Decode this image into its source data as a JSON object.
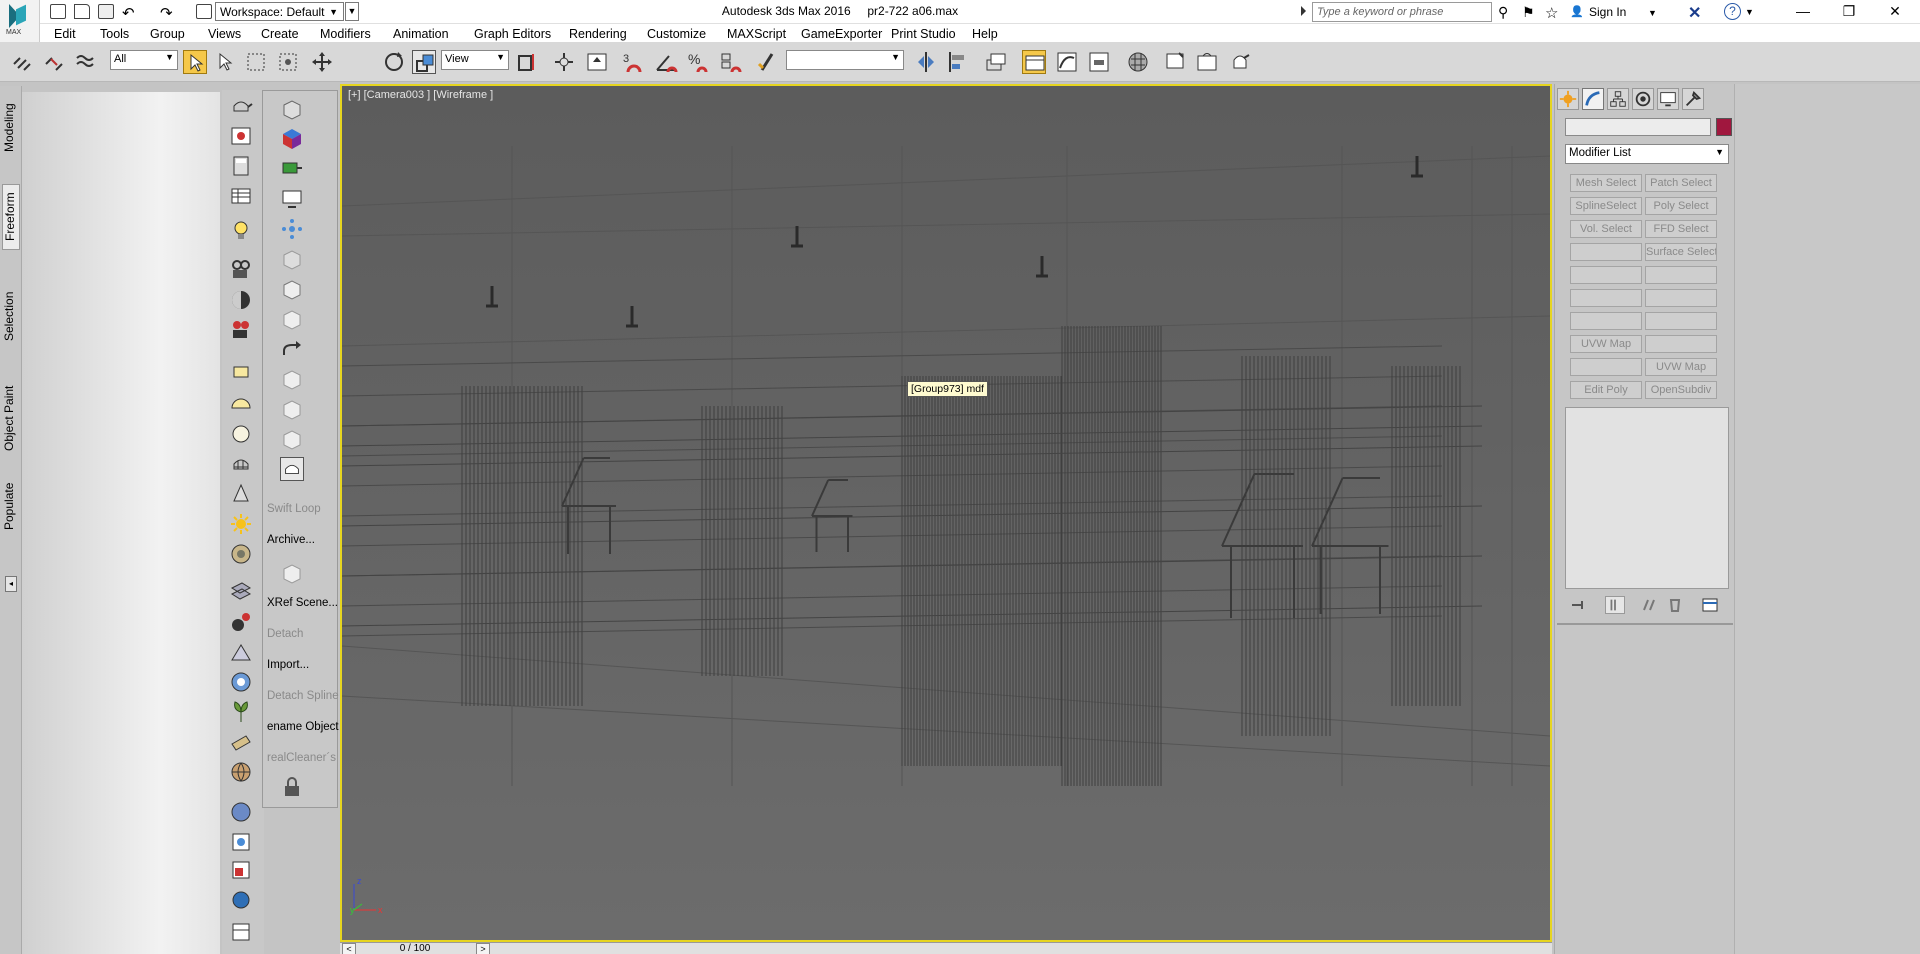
{
  "window": {
    "title": "Autodesk 3ds Max 2016",
    "filename": "pr2-722 a06.max",
    "logo_text": "MAX",
    "workspace": "Workspace: Default",
    "search_placeholder": "Type a keyword or phrase",
    "sign_in": "Sign In",
    "help_icon": "help-icon"
  },
  "menu": [
    "Edit",
    "Tools",
    "Group",
    "Views",
    "Create",
    "Modifiers",
    "Animation",
    "Graph Editors",
    "Rendering",
    "Customize",
    "MAXScript",
    "GameExporter",
    "Print Studio",
    "Help"
  ],
  "toolbar": {
    "selection_filter": "All",
    "reference_coord": "View",
    "snap_number": "3",
    "named_selection": ""
  },
  "ribbon_tabs": [
    "Modeling",
    "Freeform",
    "Selection",
    "Object Paint",
    "Populate"
  ],
  "side_strip": {
    "labels": [
      "Swift Loop",
      "Archive...",
      "XRef Scene...",
      "Detach",
      "Import...",
      "Detach Spline",
      "ename Objects",
      "realCleaner´s"
    ],
    "disabled": [
      true,
      false,
      false,
      true,
      false,
      true,
      false,
      true
    ]
  },
  "viewport": {
    "label": "[+] [Camera003 ] [Wireframe ]",
    "tooltip": "[Group973] mdf",
    "axis_x": "x",
    "axis_y": "y",
    "axis_z": "z",
    "border_color": "#e6d51f"
  },
  "timeslider": {
    "value": "0 / 100",
    "prev": "<",
    "next": ">"
  },
  "command_panel": {
    "modifier_list": "Modifier List",
    "object_color": "#a0173e",
    "buttons": [
      [
        "Mesh Select",
        "Patch Select"
      ],
      [
        "SplineSelect",
        "Poly Select"
      ],
      [
        "Vol. Select",
        "FFD Select"
      ],
      [
        "",
        "Surface Select"
      ],
      [
        "",
        ""
      ],
      [
        "",
        ""
      ],
      [
        "",
        ""
      ],
      [
        "UVW Map",
        ""
      ],
      [
        "",
        "UVW Map"
      ],
      [
        "Edit Poly",
        "OpenSubdiv"
      ]
    ]
  }
}
